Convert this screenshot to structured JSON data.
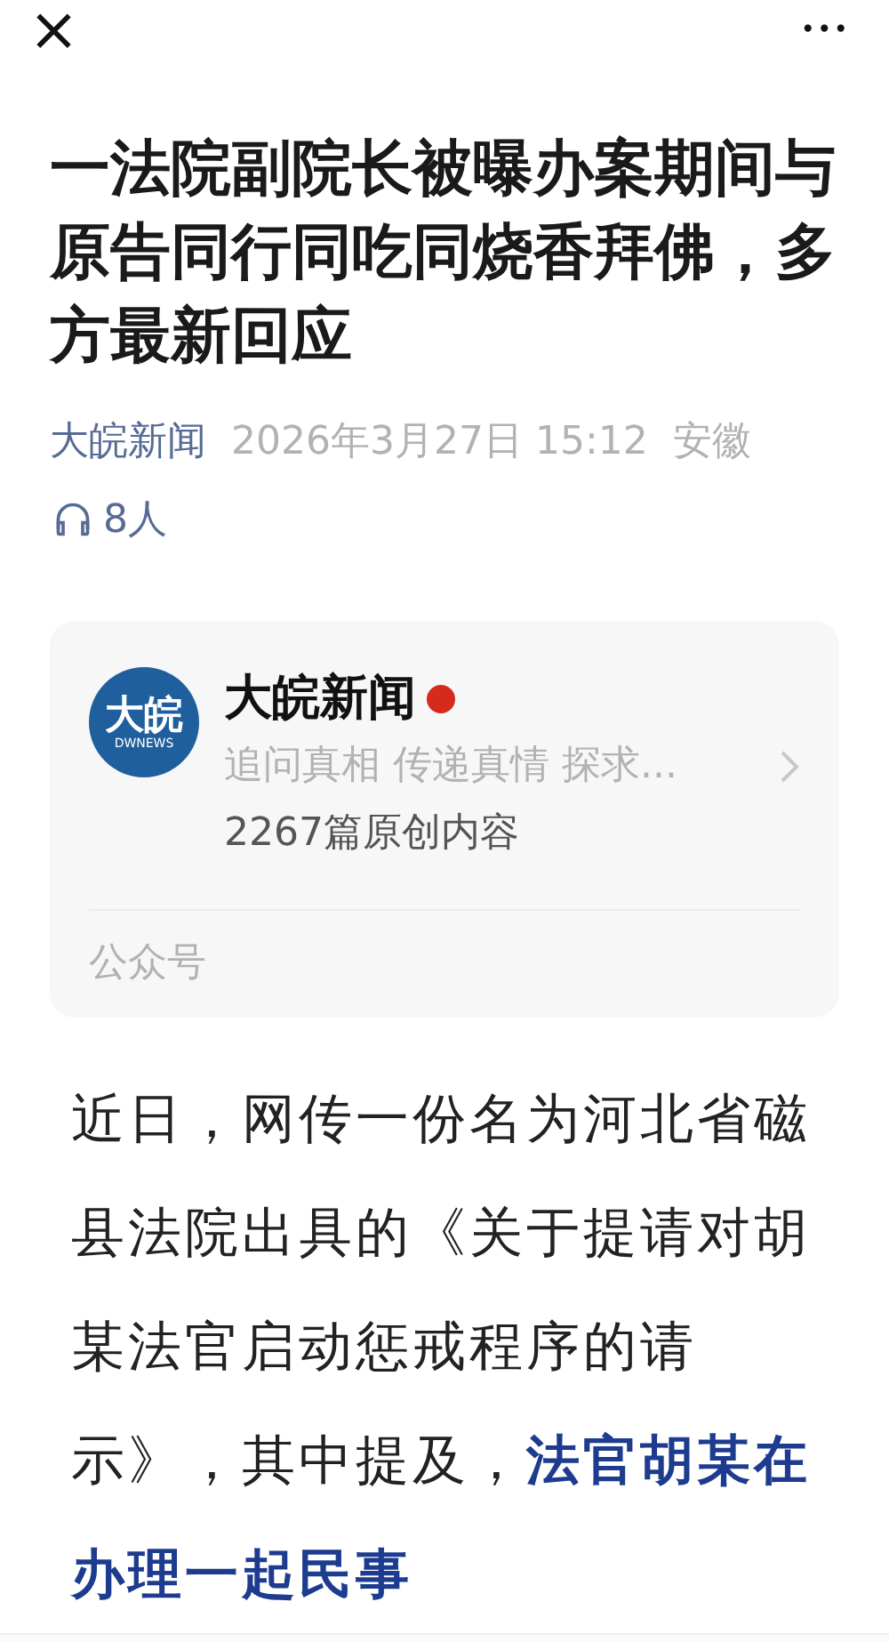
{
  "top_bar": {
    "close": "×",
    "more": "•••"
  },
  "title": "一法院副院长被曝办案期间与原告同行同吃同烧香拜佛，多方最新回应",
  "meta": {
    "source": "大皖新闻",
    "date": "2026年3月27日 15:12",
    "region": "安徽",
    "listeners": "8人"
  },
  "account_card": {
    "logo_text": "大皖",
    "logo_sub": "DWNEWS",
    "name": "大皖新闻",
    "verified": true,
    "description": "追问真相 传递真情 探求...",
    "articles": "2267篇原创内容",
    "type": "公众号"
  },
  "body": "近日，网传一份名为河北省磁县法院出具的《关于提请对胡某法官启动惩戒程序的请示》，其中提及，**法官胡某在办理一起民事**"
}
